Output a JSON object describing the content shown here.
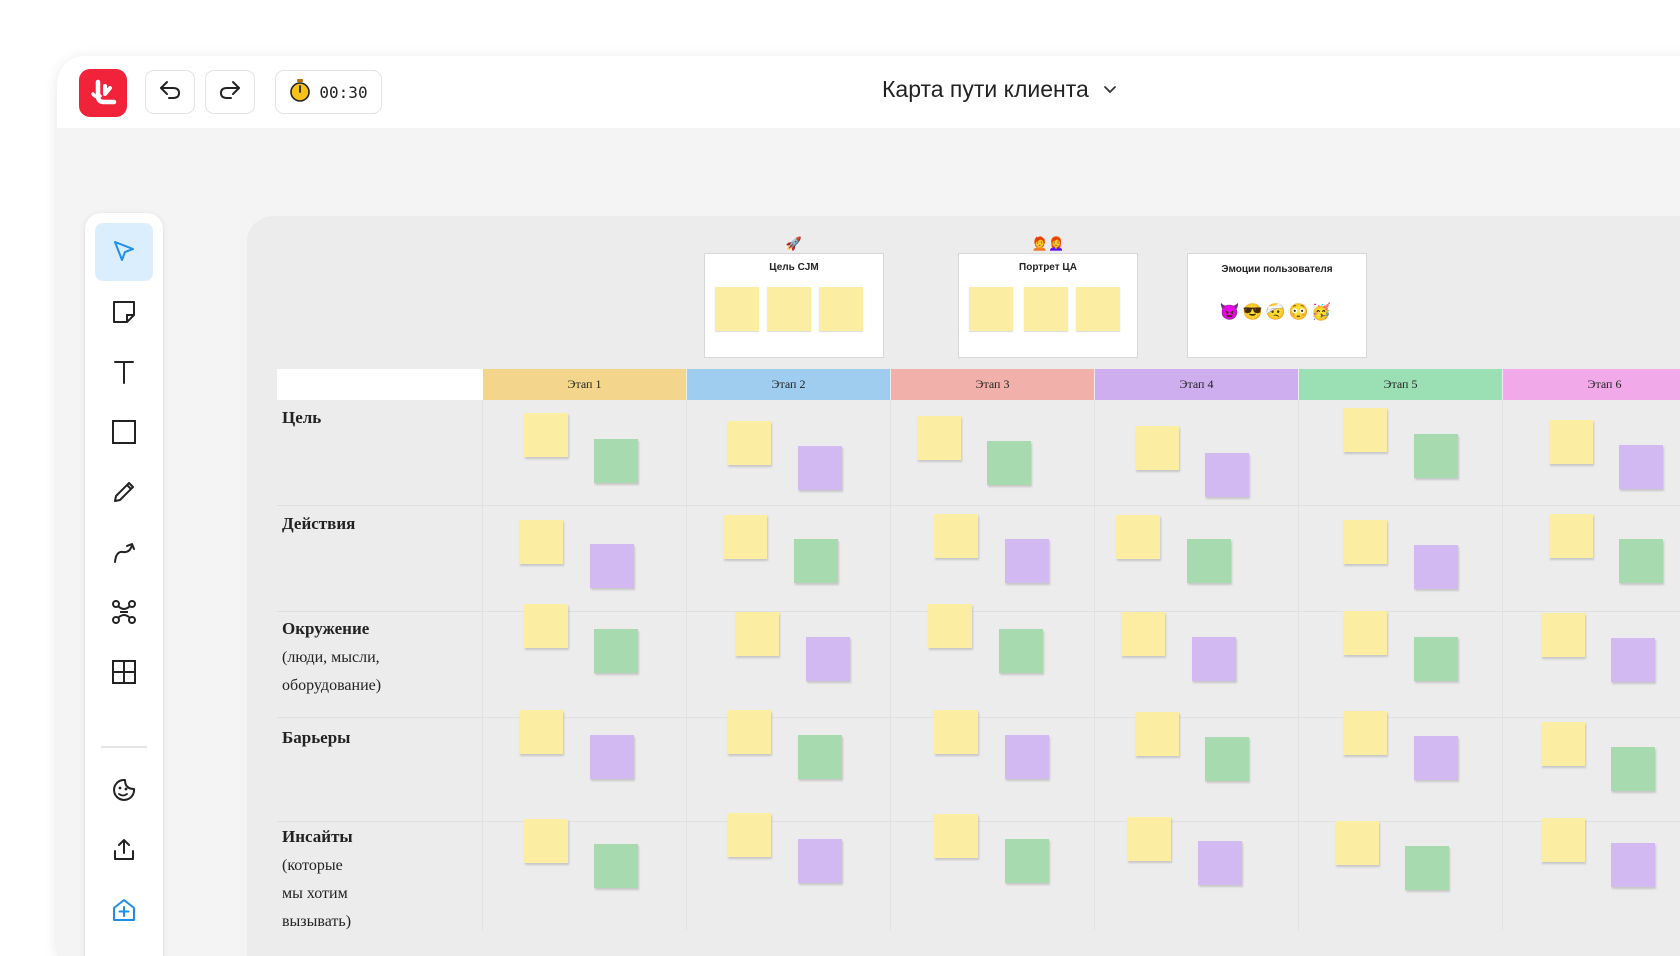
{
  "header": {
    "title": "Карта пути клиента",
    "timer": "00:30"
  },
  "icons": {
    "logo": "brand-logo-icon",
    "undo": "undo-icon",
    "redo": "redo-icon",
    "timer": "stopwatch-icon",
    "title_dropdown": "chevron-down-icon"
  },
  "toolbar": {
    "tools": [
      "select-tool",
      "sticky-note-tool",
      "text-tool",
      "shape-tool",
      "pen-tool",
      "connector-tool",
      "mindmap-tool",
      "table-tool",
      "sticker-tool",
      "upload-tool",
      "add-template-tool"
    ]
  },
  "frames": [
    {
      "label": "Цель CJM",
      "icon": "🚀"
    },
    {
      "label": "Портрет ЦА",
      "icon": "🧑‍🦰👩‍🦰"
    },
    {
      "label": "Эмоции пользователя",
      "emojis": "😈😎🤕😳🥳"
    }
  ],
  "stages": [
    {
      "label": "Этап 1",
      "color": "#f3d68b"
    },
    {
      "label": "Этап 2",
      "color": "#9fcdf0"
    },
    {
      "label": "Этап 3",
      "color": "#f2b0aa"
    },
    {
      "label": "Этап 4",
      "color": "#cfaef0"
    },
    {
      "label": "Этап 5",
      "color": "#9be0b5"
    },
    {
      "label": "Этап 6",
      "color": "#f2a9ea"
    }
  ],
  "rows": [
    {
      "title": "Цель",
      "sub": ""
    },
    {
      "title": "Действия",
      "sub": ""
    },
    {
      "title": "Окружение",
      "sub": "(люди, мысли,",
      "sub2": "оборудование)"
    },
    {
      "title": "Барьеры",
      "sub": ""
    },
    {
      "title": "Инсайты",
      "sub": "(которые мы хотим",
      "sub2": " вызывать)"
    }
  ],
  "colors": {
    "brand": "#f0233b",
    "active_tool": "#1d8fe8",
    "note_yellow": "#fbeda2",
    "note_green": "#a8dab0",
    "note_purple": "#d3b9f2"
  }
}
